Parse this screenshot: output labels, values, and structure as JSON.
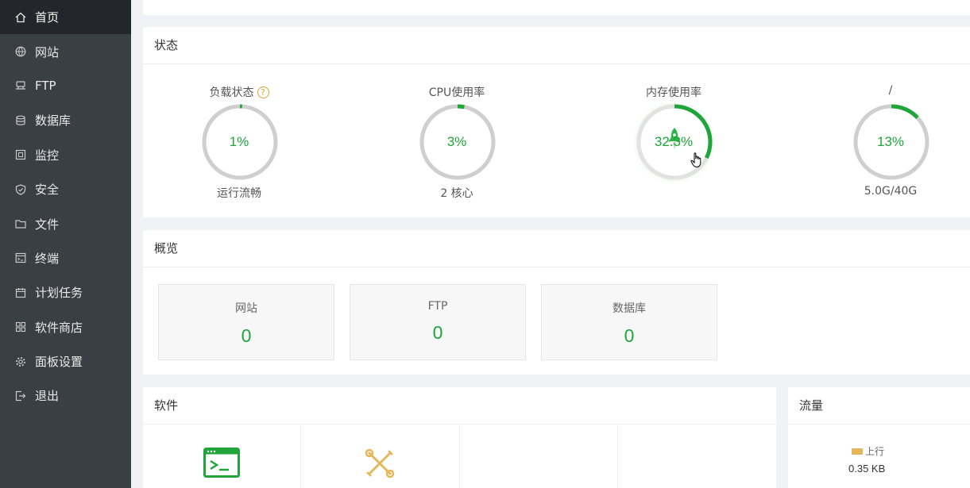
{
  "sidebar": {
    "items": [
      {
        "label": "首页",
        "icon": "home-icon",
        "active": true
      },
      {
        "label": "网站",
        "icon": "globe-icon"
      },
      {
        "label": "FTP",
        "icon": "ftp-icon"
      },
      {
        "label": "数据库",
        "icon": "database-icon"
      },
      {
        "label": "监控",
        "icon": "monitor-icon"
      },
      {
        "label": "安全",
        "icon": "shield-icon"
      },
      {
        "label": "文件",
        "icon": "folder-icon"
      },
      {
        "label": "终端",
        "icon": "terminal-icon"
      },
      {
        "label": "计划任务",
        "icon": "calendar-icon"
      },
      {
        "label": "软件商店",
        "icon": "grid-icon"
      },
      {
        "label": "面板设置",
        "icon": "gear-icon"
      },
      {
        "label": "退出",
        "icon": "logout-icon"
      }
    ]
  },
  "status": {
    "title": "状态",
    "gauges": [
      {
        "title": "负载状态",
        "value": "1%",
        "percent": 1,
        "sub": "运行流畅",
        "has_help": true
      },
      {
        "title": "CPU使用率",
        "value": "3%",
        "percent": 3,
        "sub": "2 核心"
      },
      {
        "title": "内存使用率",
        "value": "32.3%",
        "percent": 32.3,
        "sub": ""
      },
      {
        "title": "/",
        "value": "13%",
        "percent": 13,
        "sub": "5.0G/40G"
      }
    ],
    "help_glyph": "?"
  },
  "overview": {
    "title": "概览",
    "cards": [
      {
        "label": "网站",
        "value": "0"
      },
      {
        "label": "FTP",
        "value": "0"
      },
      {
        "label": "数据库",
        "value": "0"
      }
    ]
  },
  "software": {
    "title": "软件",
    "items": [
      {
        "icon": "terminal-app-icon"
      },
      {
        "icon": "tools-icon"
      },
      {
        "icon": ""
      },
      {
        "icon": ""
      }
    ]
  },
  "traffic": {
    "title": "流量",
    "legend_label": "上行",
    "value": "0.35 KB"
  },
  "colors": {
    "accent": "#20a53a",
    "sidebar_bg": "#3a3f44",
    "sidebar_active": "#23272b",
    "ring_track": "#d0d0d0",
    "upload_swatch": "#e4b75a"
  }
}
